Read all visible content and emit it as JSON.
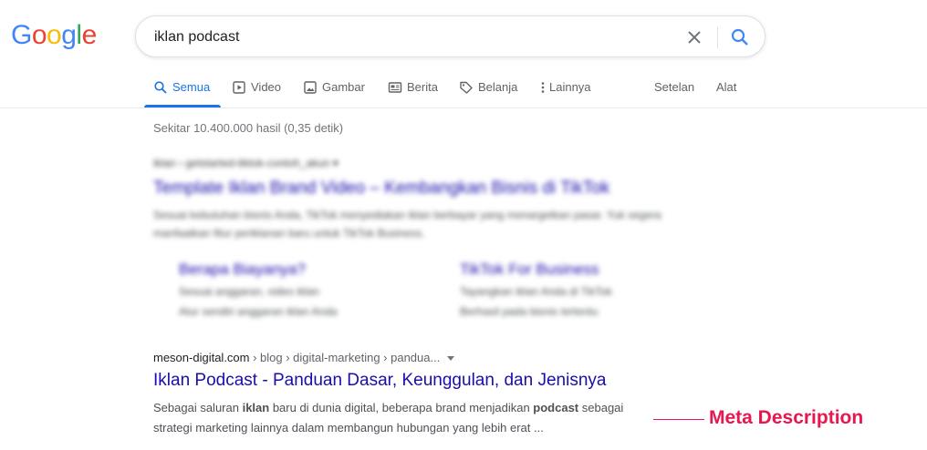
{
  "logo": {
    "letters": [
      "G",
      "o",
      "o",
      "g",
      "l",
      "e"
    ],
    "colors": [
      "#4285f4",
      "#ea4335",
      "#fbbc05",
      "#4285f4",
      "#34a853",
      "#ea4335"
    ]
  },
  "search": {
    "value": "iklan podcast"
  },
  "tabs": [
    {
      "label": "Semua",
      "icon": "search-icon"
    },
    {
      "label": "Video",
      "icon": "video-icon"
    },
    {
      "label": "Gambar",
      "icon": "image-icon"
    },
    {
      "label": "Berita",
      "icon": "news-icon"
    },
    {
      "label": "Belanja",
      "icon": "tag-icon"
    },
    {
      "label": "Lainnya",
      "icon": "more-vert-icon"
    }
  ],
  "tools": {
    "settings": "Setelan",
    "tools": "Alat"
  },
  "stats": "Sekitar 10.400.000 hasil (0,35 detik)",
  "blurred_result": {
    "url": "iklan › getstarted-tiktok-contoh_akun ▾",
    "title": "Template Iklan Brand Video – Kembangkan Bisnis di TikTok",
    "snippet": "Sesuai kebutuhan bisnis Anda, TikTok menyediakan iklan berbayar yang menargetkan pasar. Yuk segera manfaatkan fitur periklanan baru untuk TikTok Business.",
    "sitelinks": [
      {
        "title": "Berapa Biayanya?",
        "lines": [
          "Sesuai anggaran, video iklan",
          "Atur sendiri anggaran iklan Anda"
        ]
      },
      {
        "title": "TikTok For Business",
        "lines": [
          "Tayangkan iklan Anda di TikTok",
          "Berhasil pada bisnis tertentu"
        ]
      }
    ]
  },
  "result": {
    "domain": "meson-digital.com",
    "breadcrumb": " › blog › digital-marketing › pandua...",
    "title": "Iklan Podcast - Panduan Dasar, Keunggulan, dan Jenisnya",
    "snippet": {
      "p1": "Sebagai saluran ",
      "b1": "iklan",
      "p2": " baru di dunia digital, beberapa brand menjadikan ",
      "b2": "podcast",
      "p3": " sebagai strategi marketing lainnya dalam membangun hubungan yang lebih erat ..."
    }
  },
  "annotation": {
    "label": "Meta Description",
    "color": "#e8174f"
  }
}
